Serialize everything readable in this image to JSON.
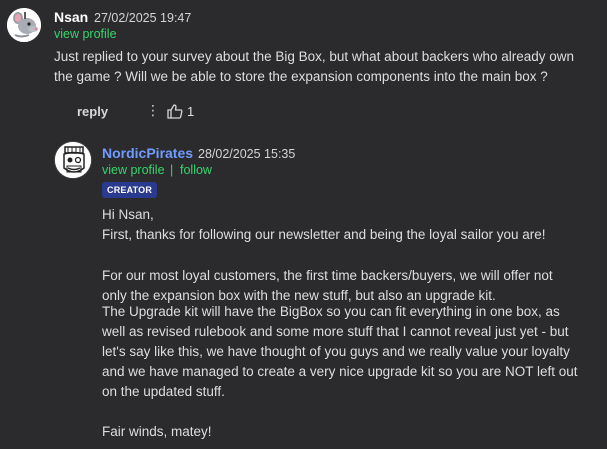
{
  "comment": {
    "author": "Nsan",
    "date": "27/02/2025 19:47",
    "view_profile": "view profile",
    "text_line1": "Just replied to your survey about the Big Box, but what about backers who already own",
    "text_line2": "the game ? Will we be able to store the expansion components into the main box ?",
    "reply_label": "reply",
    "like_count": "1"
  },
  "reply": {
    "author": "NordicPirates",
    "date": "28/02/2025 15:35",
    "view_profile": "view profile",
    "separator": "|",
    "follow": "follow",
    "badge": "CREATOR",
    "lines": [
      "Hi Nsan,",
      "First, thanks for following our newsletter and being the loyal sailor you are!",
      "For our most loyal customers, the first time backers/buyers, we will offer not",
      "only the expansion box with the new stuff, but also an upgrade kit.",
      "The Upgrade kit will have the BigBox so you can fit everything in one box, as",
      "well as revised rulebook and some more stuff that I cannot reveal just yet - but",
      "let's say like this, we have thought of you guys and we really value your loyalty",
      "and we have managed to create a very nice upgrade kit so you are NOT left out",
      "on the updated stuff.",
      "Fair winds, matey!"
    ]
  },
  "colors": {
    "background": "#2b2b2e",
    "link": "#36d46b",
    "creator_name": "#6f9bff",
    "badge_bg": "#2a3a8e"
  },
  "icons": {
    "avatar1": "rat-avatar",
    "avatar2": "pirate-avatar",
    "kebab": "more-options-icon",
    "like": "thumbs-up-icon"
  }
}
